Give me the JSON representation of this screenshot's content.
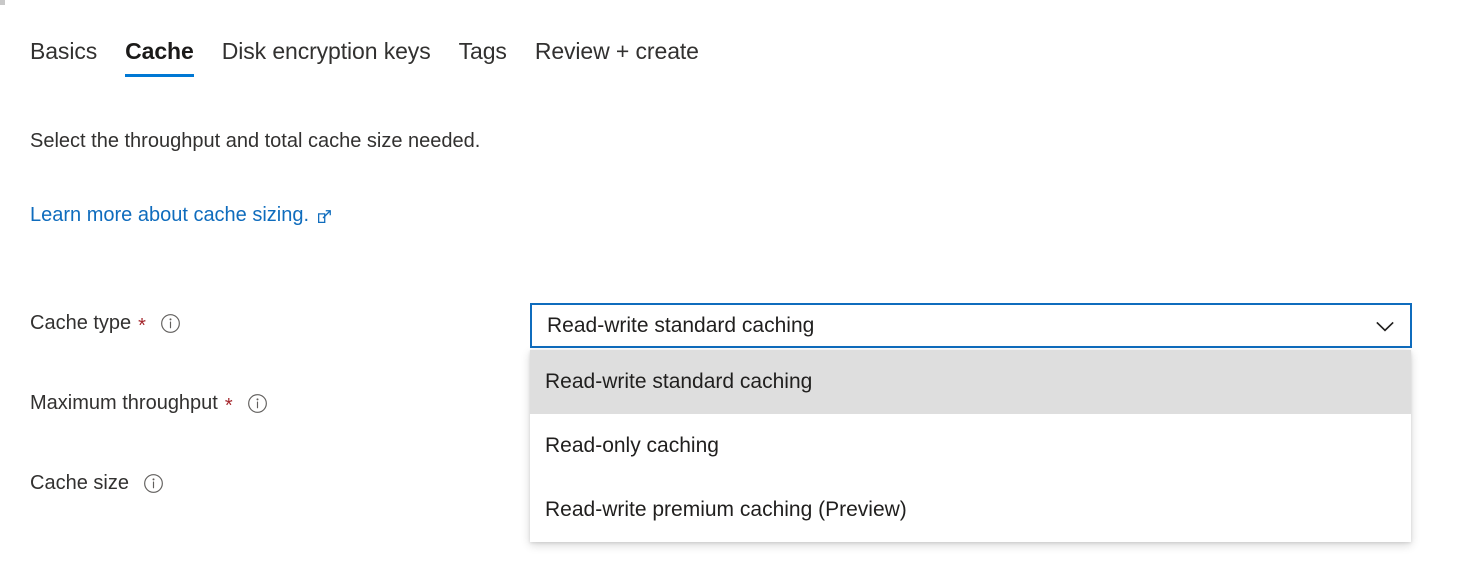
{
  "window": {
    "background_color": "#ffffff",
    "accent_color": "#0078d4"
  },
  "tabs": [
    {
      "label": "Basics",
      "active": false
    },
    {
      "label": "Cache",
      "active": true
    },
    {
      "label": "Disk encryption keys",
      "active": false
    },
    {
      "label": "Tags",
      "active": false
    },
    {
      "label": "Review + create",
      "active": false
    }
  ],
  "content": {
    "description": "Select the throughput and total cache size needed.",
    "learn_more": {
      "text": "Learn more about cache sizing.",
      "icon": "external-link-icon",
      "color": "#0f6cbd"
    }
  },
  "fields": [
    {
      "label": "Cache type",
      "required": true,
      "required_marker": "*",
      "info_icon": "info-icon"
    },
    {
      "label": "Maximum throughput",
      "required": true,
      "required_marker": "*",
      "info_icon": "info-icon"
    },
    {
      "label": "Cache size",
      "required": false,
      "required_marker": "",
      "info_icon": "info-icon"
    }
  ],
  "cache_type_dropdown": {
    "selected_value": "Read-write standard caching",
    "expanded": true,
    "chevron_icon": "chevron-down-icon",
    "focus_border_color": "#0f6cbd",
    "highlight_color": "#dedede",
    "options": [
      {
        "label": "Read-write standard caching",
        "selected": true
      },
      {
        "label": "Read-only caching",
        "selected": false
      },
      {
        "label": "Read-write premium caching (Preview)",
        "selected": false
      }
    ]
  },
  "required_marker_color": "#a4262c"
}
